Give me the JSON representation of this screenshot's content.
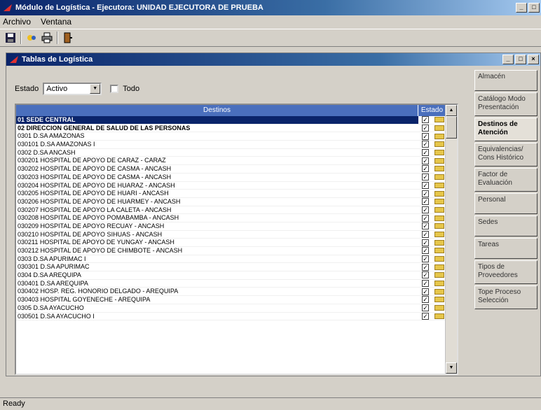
{
  "window": {
    "title": "Módulo de Logística - Ejecutora: UNIDAD EJECUTORA DE PRUEBA"
  },
  "menu": {
    "items": [
      "Archivo",
      "Ventana"
    ]
  },
  "child": {
    "title": "Tablas de Logística"
  },
  "filter": {
    "label": "Estado",
    "value": "Activo",
    "all_label": "Todo"
  },
  "grid": {
    "headers": {
      "destino": "Destinos",
      "estado": "Estado"
    },
    "rows": [
      {
        "text": "01  SEDE CENTRAL",
        "style": "sel"
      },
      {
        "text": "02  DIRECCION GENERAL DE SALUD DE LAS PERSONAS",
        "style": "bold"
      },
      {
        "text": "0301  D.SA AMAZONAS",
        "style": ""
      },
      {
        "text": "    030101  D.SA AMAZONAS I",
        "style": ""
      },
      {
        "text": "0302  D.SA ANCASH",
        "style": ""
      },
      {
        "text": "    030201  HOSPITAL DE APOYO DE CARAZ - CARAZ",
        "style": ""
      },
      {
        "text": "    030202  HOSPITAL DE APOYO DE CASMA - ANCASH",
        "style": ""
      },
      {
        "text": "    030203  HOSPITAL DE APOYO DE CASMA - ANCASH",
        "style": ""
      },
      {
        "text": "    030204  HOSPITAL DE APOYO DE HUARAZ - ANCASH",
        "style": ""
      },
      {
        "text": "    030205  HOSPITAL DE APOYO DE HUARI - ANCASH",
        "style": ""
      },
      {
        "text": "    030206  HOSPITAL DE APOYO DE HUARMEY - ANCASH",
        "style": ""
      },
      {
        "text": "    030207  HOSPITAL DE APOYO LA CALETA - ANCASH",
        "style": ""
      },
      {
        "text": "    030208  HOSPITAL DE APOYO POMABAMBA - ANCASH",
        "style": ""
      },
      {
        "text": "    030209  HOSPITAL DE APOYO RECUAY - ANCASH",
        "style": ""
      },
      {
        "text": "    030210  HOSPITAL DE APOYO SIHUAS - ANCASH",
        "style": ""
      },
      {
        "text": "    030211  HOSPITAL DE APOYO DE YUNGAY - ANCASH",
        "style": ""
      },
      {
        "text": "    030212  HOSPITAL DE APOYO DE CHIMBOTE - ANCASH",
        "style": ""
      },
      {
        "text": "0303  D.SA APURIMAC I",
        "style": ""
      },
      {
        "text": "    030301  D.SA APURIMAC",
        "style": ""
      },
      {
        "text": "0304  D.SA AREQUIPA",
        "style": ""
      },
      {
        "text": "    030401  D.SA AREQUIPA",
        "style": ""
      },
      {
        "text": "    030402  HOSP. REG. HONORIO DELGADO - AREQUIPA",
        "style": ""
      },
      {
        "text": "    030403  HOSPITAL GOYENECHE - AREQUIPA",
        "style": ""
      },
      {
        "text": "0305  D.SA AYACUCHO",
        "style": ""
      },
      {
        "text": "    030501  D.SA AYACUCHO I",
        "style": ""
      }
    ]
  },
  "sidepanel": {
    "items": [
      {
        "label": "Almacén",
        "active": false
      },
      {
        "label": "Catálogo Modo Presentación",
        "active": false
      },
      {
        "label": "Destinos de Atención",
        "active": true
      },
      {
        "label": "Equivalencias/ Cons Histórico",
        "active": false
      },
      {
        "label": "Factor de Evaluación",
        "active": false
      },
      {
        "label": "Personal",
        "active": false
      },
      {
        "label": "Sedes",
        "active": false
      },
      {
        "label": "Tareas",
        "active": false
      },
      {
        "label": "Tipos de Proveedores",
        "active": false
      },
      {
        "label": "Tope Proceso Selección",
        "active": false
      }
    ]
  },
  "status": {
    "text": "Ready"
  }
}
